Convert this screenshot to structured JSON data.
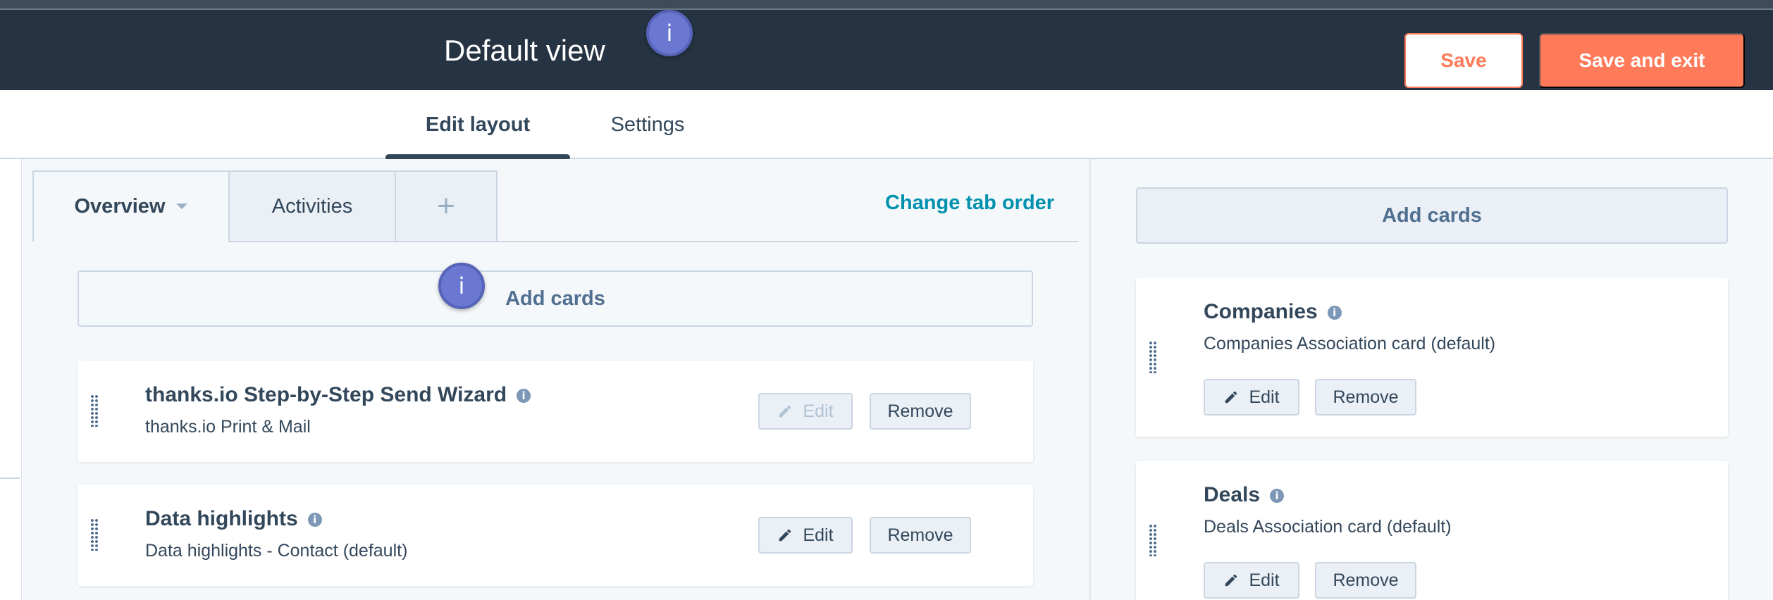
{
  "header": {
    "title": "Default view",
    "info_badge": "i",
    "save_label": "Save",
    "save_exit_label": "Save and exit"
  },
  "top_tabs": [
    {
      "label": "Edit layout",
      "active": true
    },
    {
      "label": "Settings",
      "active": false
    }
  ],
  "sub_tabs": {
    "overview": "Overview",
    "activities": "Activities",
    "add": "+"
  },
  "change_tab_order": "Change tab order",
  "main": {
    "add_cards": "Add cards",
    "info_badge": "i",
    "cards": [
      {
        "title": "thanks.io Step-by-Step Send Wizard",
        "subtitle": "thanks.io Print & Mail",
        "edit": "Edit",
        "edit_disabled": true,
        "remove": "Remove"
      },
      {
        "title": "Data highlights",
        "subtitle": "Data highlights - Contact (default)",
        "edit": "Edit",
        "edit_disabled": false,
        "remove": "Remove"
      }
    ]
  },
  "sidebar": {
    "add_cards": "Add cards",
    "cards": [
      {
        "title": "Companies",
        "subtitle": "Companies Association card (default)",
        "edit": "Edit",
        "remove": "Remove"
      },
      {
        "title": "Deals",
        "subtitle": "Deals Association card (default)",
        "edit": "Edit",
        "remove": "Remove"
      }
    ]
  },
  "colors": {
    "header_bg": "#253342",
    "accent": "#ff7a59",
    "link": "#0091ae",
    "badge": "#6a78d1"
  }
}
